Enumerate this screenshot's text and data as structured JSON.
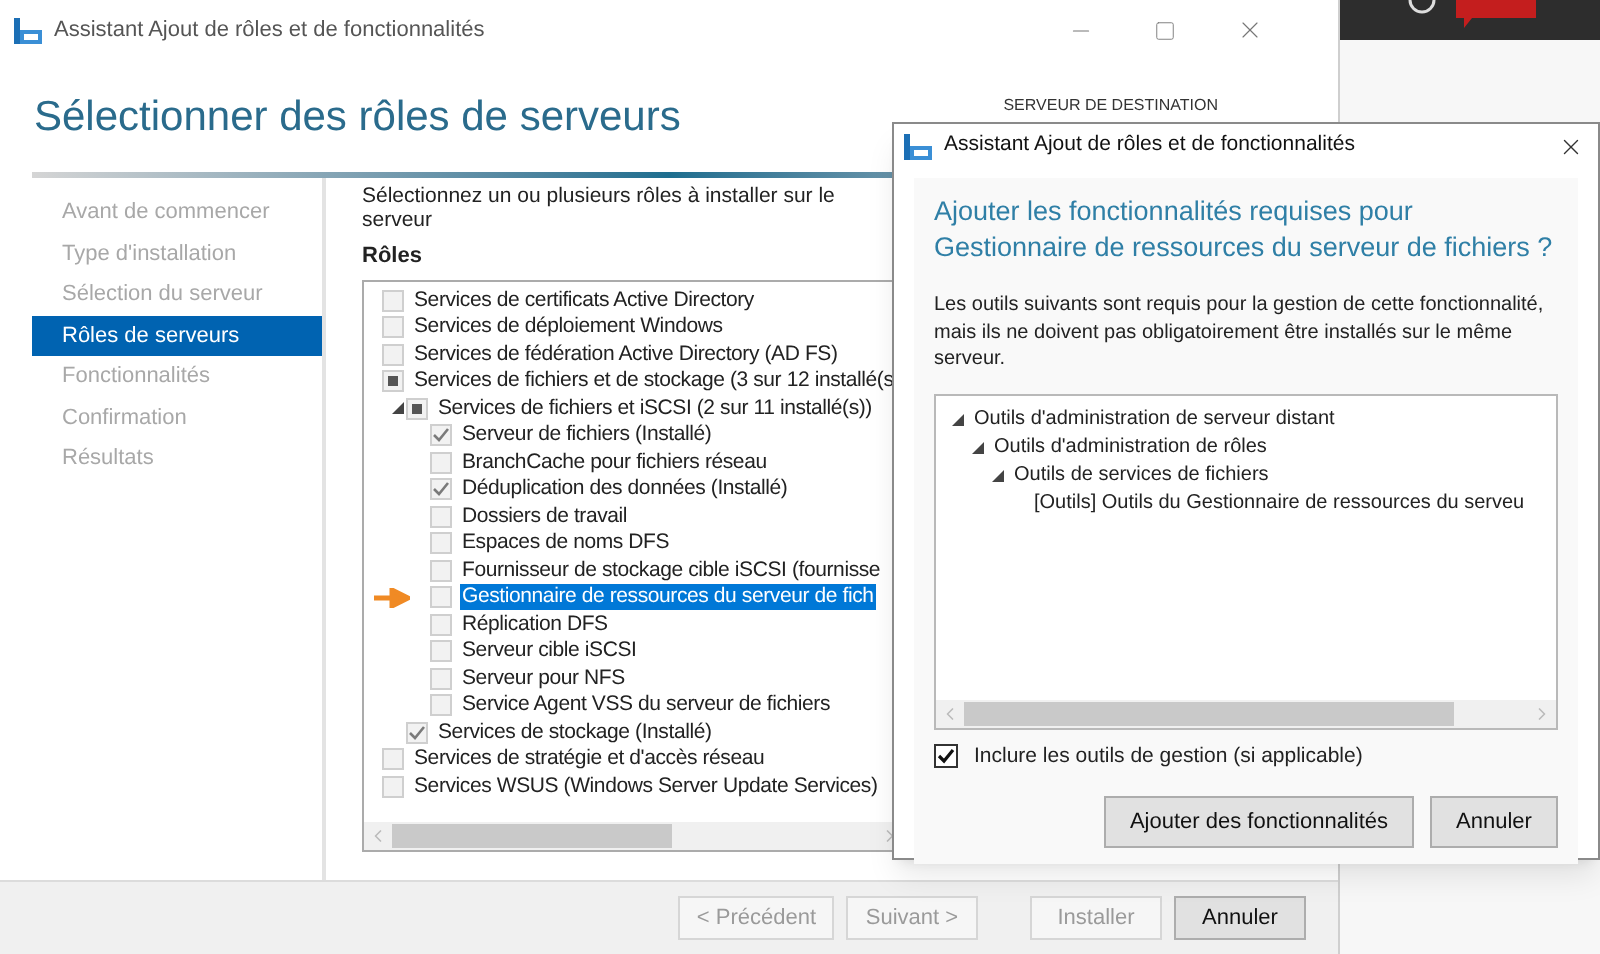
{
  "main_window": {
    "title": "Assistant Ajout de rôles et de fonctionnalités",
    "heading": "Sélectionner des rôles de serveurs",
    "destination_label": "SERVEUR DE DESTINATION",
    "nav": [
      {
        "label": "Avant de commencer",
        "selected": false
      },
      {
        "label": "Type d'installation",
        "selected": false
      },
      {
        "label": "Sélection du serveur",
        "selected": false
      },
      {
        "label": "Rôles de serveurs",
        "selected": true
      },
      {
        "label": "Fonctionnalités",
        "selected": false
      },
      {
        "label": "Confirmation",
        "selected": false
      },
      {
        "label": "Résultats",
        "selected": false
      }
    ],
    "instruction": "Sélectionnez un ou plusieurs rôles à installer sur le serveur",
    "roles_label": "Rôles",
    "roles": [
      {
        "label": "Services de certificats Active Directory",
        "checked": false,
        "partial": false,
        "selected": false,
        "arrow": false
      },
      {
        "label": "Services de déploiement Windows",
        "checked": false,
        "partial": false,
        "selected": false,
        "arrow": false
      },
      {
        "label": "Services de fédération Active Directory (AD FS)",
        "checked": false,
        "partial": false,
        "selected": false,
        "arrow": false
      },
      {
        "label": "Services de fichiers et de stockage (3 sur 12 installé(s",
        "checked": false,
        "partial": true,
        "selected": false,
        "arrow": false,
        "children": [
          {
            "label": "Services de fichiers et iSCSI (2 sur 11 installé(s))",
            "checked": false,
            "partial": true,
            "selected": false,
            "arrow": false,
            "expanded": true,
            "children": [
              {
                "label": "Serveur de fichiers (Installé)",
                "checked": true,
                "partial": false,
                "selected": false,
                "arrow": false
              },
              {
                "label": "BranchCache pour fichiers réseau",
                "checked": false,
                "partial": false,
                "selected": false,
                "arrow": false
              },
              {
                "label": "Déduplication des données (Installé)",
                "checked": true,
                "partial": false,
                "selected": false,
                "arrow": false
              },
              {
                "label": "Dossiers de travail",
                "checked": false,
                "partial": false,
                "selected": false,
                "arrow": false
              },
              {
                "label": "Espaces de noms DFS",
                "checked": false,
                "partial": false,
                "selected": false,
                "arrow": false
              },
              {
                "label": "Fournisseur de stockage cible iSCSI (fournisse",
                "checked": false,
                "partial": false,
                "selected": false,
                "arrow": false
              },
              {
                "label": "Gestionnaire de ressources du serveur de fich",
                "checked": false,
                "partial": false,
                "selected": true,
                "arrow": true
              },
              {
                "label": "Réplication DFS",
                "checked": false,
                "partial": false,
                "selected": false,
                "arrow": false
              },
              {
                "label": "Serveur cible iSCSI",
                "checked": false,
                "partial": false,
                "selected": false,
                "arrow": false
              },
              {
                "label": "Serveur pour NFS",
                "checked": false,
                "partial": false,
                "selected": false,
                "arrow": false
              },
              {
                "label": "Service Agent VSS du serveur de fichiers",
                "checked": false,
                "partial": false,
                "selected": false,
                "arrow": false
              }
            ]
          },
          {
            "label": "Services de stockage (Installé)",
            "checked": true,
            "partial": false,
            "selected": false,
            "arrow": false
          }
        ]
      },
      {
        "label": "Services de stratégie et d'accès réseau",
        "checked": false,
        "partial": false,
        "selected": false,
        "arrow": false
      },
      {
        "label": "Services WSUS (Windows Server Update Services)",
        "checked": false,
        "partial": false,
        "selected": false,
        "arrow": false
      }
    ],
    "buttons": [
      {
        "label": "< Précédent",
        "disabled": true
      },
      {
        "label": "Suivant >",
        "disabled": true
      },
      {
        "label": "Installer",
        "disabled": true
      },
      {
        "label": "Annuler",
        "disabled": false
      }
    ]
  },
  "dialog": {
    "title": "Assistant Ajout de rôles et de fonctionnalités",
    "heading": "Ajouter les fonctionnalités requises pour Gestionnaire de ressources du serveur de fichiers ?",
    "description": "Les outils suivants sont requis pour la gestion de cette fonctionnalité, mais ils ne doivent pas obligatoirement être installés sur le même serveur.",
    "tree": [
      {
        "label": "Outils d'administration de serveur distant",
        "expanded": true,
        "children": [
          {
            "label": "Outils d'administration de rôles",
            "expanded": true,
            "children": [
              {
                "label": "Outils de services de fichiers",
                "expanded": true,
                "children": [
                  {
                    "label": "[Outils] Outils du Gestionnaire de ressources du serveu"
                  }
                ]
              }
            ]
          }
        ]
      }
    ],
    "include_tools": {
      "label": "Inclure les outils de gestion (si applicable)",
      "checked": true
    },
    "buttons": [
      {
        "label": "Ajouter des fonctionnalités",
        "disabled": false
      },
      {
        "label": "Annuler",
        "disabled": false
      }
    ]
  }
}
